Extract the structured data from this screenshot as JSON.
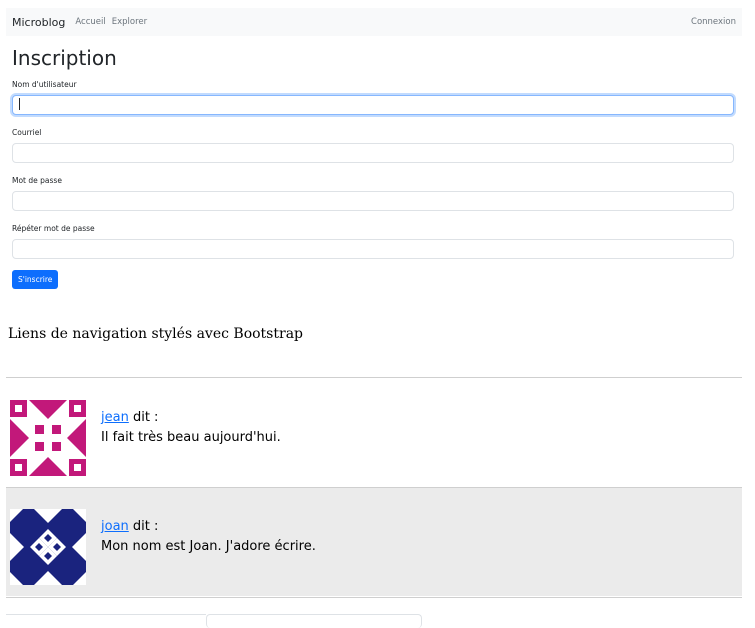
{
  "navbar": {
    "brand": "Microblog",
    "links": [
      "Accueil",
      "Explorer"
    ],
    "login": "Connexion"
  },
  "form": {
    "title": "Inscription",
    "fields": [
      {
        "label": "Nom d'utilisateur",
        "value": ""
      },
      {
        "label": "Courriel",
        "value": ""
      },
      {
        "label": "Mot de passe",
        "value": ""
      },
      {
        "label": "Répéter mot de passe",
        "value": ""
      }
    ],
    "submit": "S'inscrire"
  },
  "caption": "Liens de navigation stylés avec Bootstrap",
  "posts": [
    {
      "author": "jean",
      "says": " dit :",
      "body": "Il fait très beau aujourd'hui."
    },
    {
      "author": "joan",
      "says": " dit :",
      "body": "Mon nom est Joan. J'adore écrire."
    }
  ],
  "colors": {
    "accent": "#0d6efd",
    "avatar_jean": "#c2187a",
    "avatar_joan": "#1a237e",
    "post_alt_bg": "#ebebeb"
  }
}
